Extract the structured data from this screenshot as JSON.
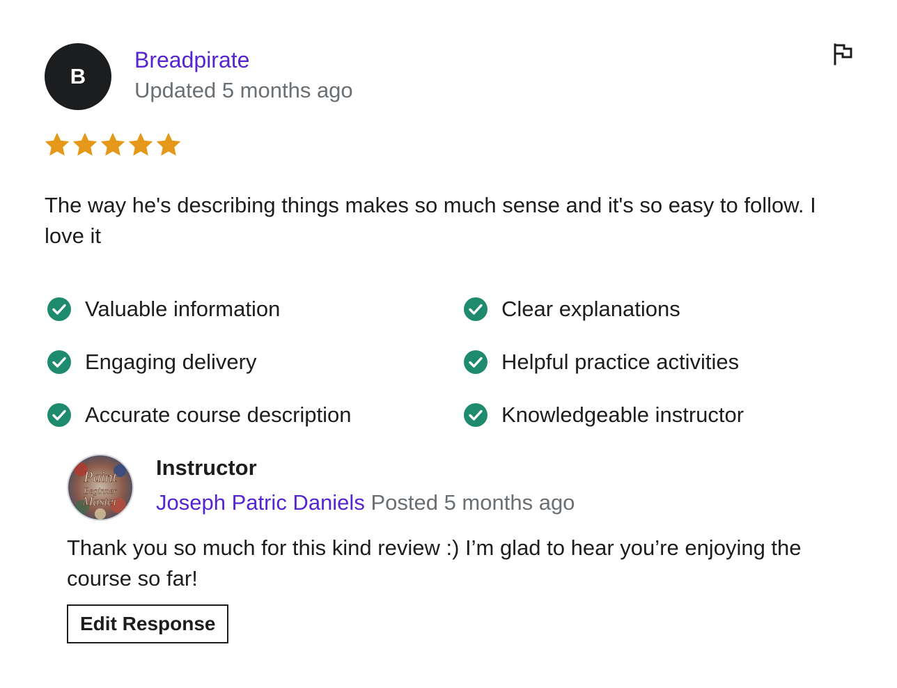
{
  "review": {
    "avatar_initial": "B",
    "reviewer_name": "Breadpirate",
    "date": "Updated 5 months ago",
    "rating": 5,
    "max_rating": 5,
    "star_color": "#e59819",
    "text": "The way he's describing things makes so much sense and it's so easy to follow. I love it",
    "flag_icon": "flag-icon"
  },
  "feedback": {
    "check_color": "#1e8a6e",
    "items": [
      {
        "label": "Valuable information"
      },
      {
        "label": "Clear explanations"
      },
      {
        "label": "Engaging delivery"
      },
      {
        "label": "Helpful practice activities"
      },
      {
        "label": "Accurate course description"
      },
      {
        "label": "Knowledgeable instructor"
      }
    ]
  },
  "response": {
    "role": "Instructor",
    "instructor_name": "Joseph Patric Daniels",
    "date": "Posted 5 months ago",
    "text": "Thank you so much for this kind review :) I’m glad to hear you’re enjoying the course so far!",
    "edit_button_label": "Edit Response",
    "avatar_logo_lines": [
      "Paint",
      "Beginner",
      "Master"
    ]
  },
  "colors": {
    "link": "#5624d0",
    "muted": "#6a6f73",
    "text": "#1c1d1f"
  }
}
